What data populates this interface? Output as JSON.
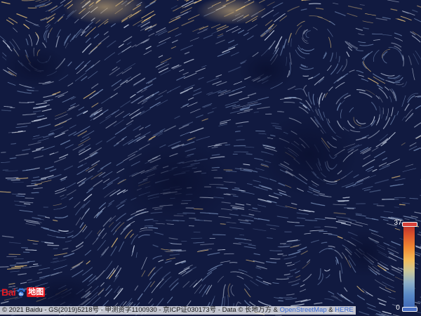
{
  "map": {
    "layer": "wind flow field",
    "colors": {
      "background": "#0e1638",
      "streak_low": "#6f86b0",
      "streak_mid": "#c8d2e4",
      "streak_high": "#e7c27a"
    }
  },
  "logo": {
    "brand_text": "Bai",
    "paw_icon": "baidu-paw-icon",
    "product_text": "地图",
    "brand_color": "#e21b23"
  },
  "copyright": {
    "text": "© 2021 Baidu - GS(2019)5218号 - 甲测资字1100930 - 京ICP证030173号 - Data © 长地万方 & ",
    "osm_link": "OpenStreetMap",
    "separator": " & ",
    "here_link": "HERE"
  },
  "legend": {
    "max_label": "37",
    "min_label": "0"
  }
}
